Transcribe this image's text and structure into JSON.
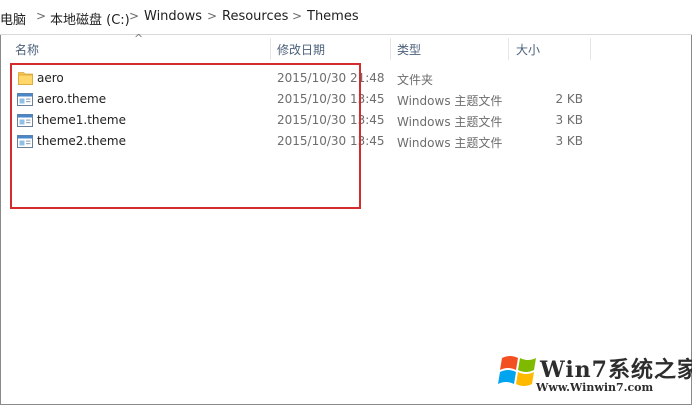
{
  "breadcrumb": {
    "items": [
      "电脑",
      "本地磁盘 (C:)",
      "Windows",
      "Resources",
      "Themes"
    ],
    "separator": ">"
  },
  "columns": {
    "name": "名称",
    "date": "修改日期",
    "type": "类型",
    "size": "大小"
  },
  "files": [
    {
      "name": "aero",
      "date": "2015/10/30 21:48",
      "type": "文件夹",
      "size": "",
      "icon": "folder-icon"
    },
    {
      "name": "aero.theme",
      "date": "2015/10/30 13:45",
      "type": "Windows 主题文件",
      "size": "2 KB",
      "icon": "theme-file-icon"
    },
    {
      "name": "theme1.theme",
      "date": "2015/10/30 13:45",
      "type": "Windows 主题文件",
      "size": "3 KB",
      "icon": "theme-file-icon"
    },
    {
      "name": "theme2.theme",
      "date": "2015/10/30 13:45",
      "type": "Windows 主题文件",
      "size": "3 KB",
      "icon": "theme-file-icon"
    }
  ],
  "watermark": {
    "brand": "Win7系统之家",
    "url": "Www.Winwin7.com"
  },
  "colors": {
    "highlight": "#d42c2c",
    "folder": "#f5c84c",
    "header_text": "#4c607a"
  }
}
